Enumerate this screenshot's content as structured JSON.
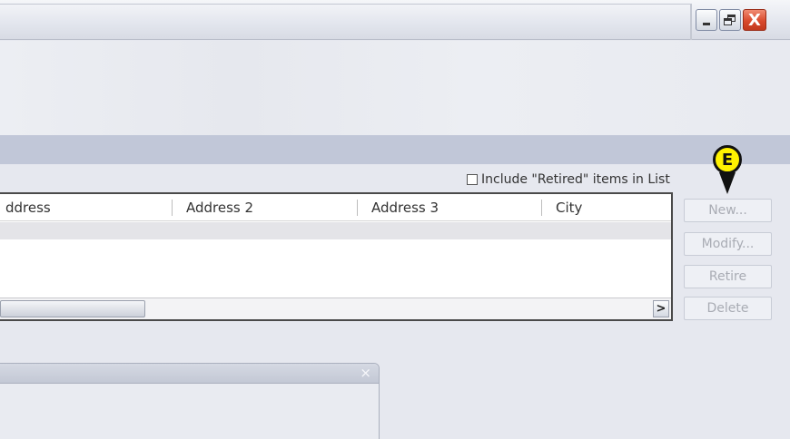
{
  "window": {
    "controls": {
      "minimize_icon": "minimize-icon",
      "restore_icon": "restore-icon",
      "close_icon": "close-icon",
      "close_glyph": "X"
    }
  },
  "list": {
    "include_retired_label": "Include \"Retired\" items in List",
    "include_retired_checked": false,
    "columns": [
      "ddress",
      "Address 2",
      "Address 3",
      "City"
    ],
    "scroll_right_glyph": ">"
  },
  "buttons": {
    "new": "New...",
    "modify": "Modify...",
    "retire": "Retire",
    "delete": "Delete"
  },
  "callout": {
    "label": "E",
    "color": "#fff200"
  },
  "panel": {
    "close_glyph": "×"
  }
}
